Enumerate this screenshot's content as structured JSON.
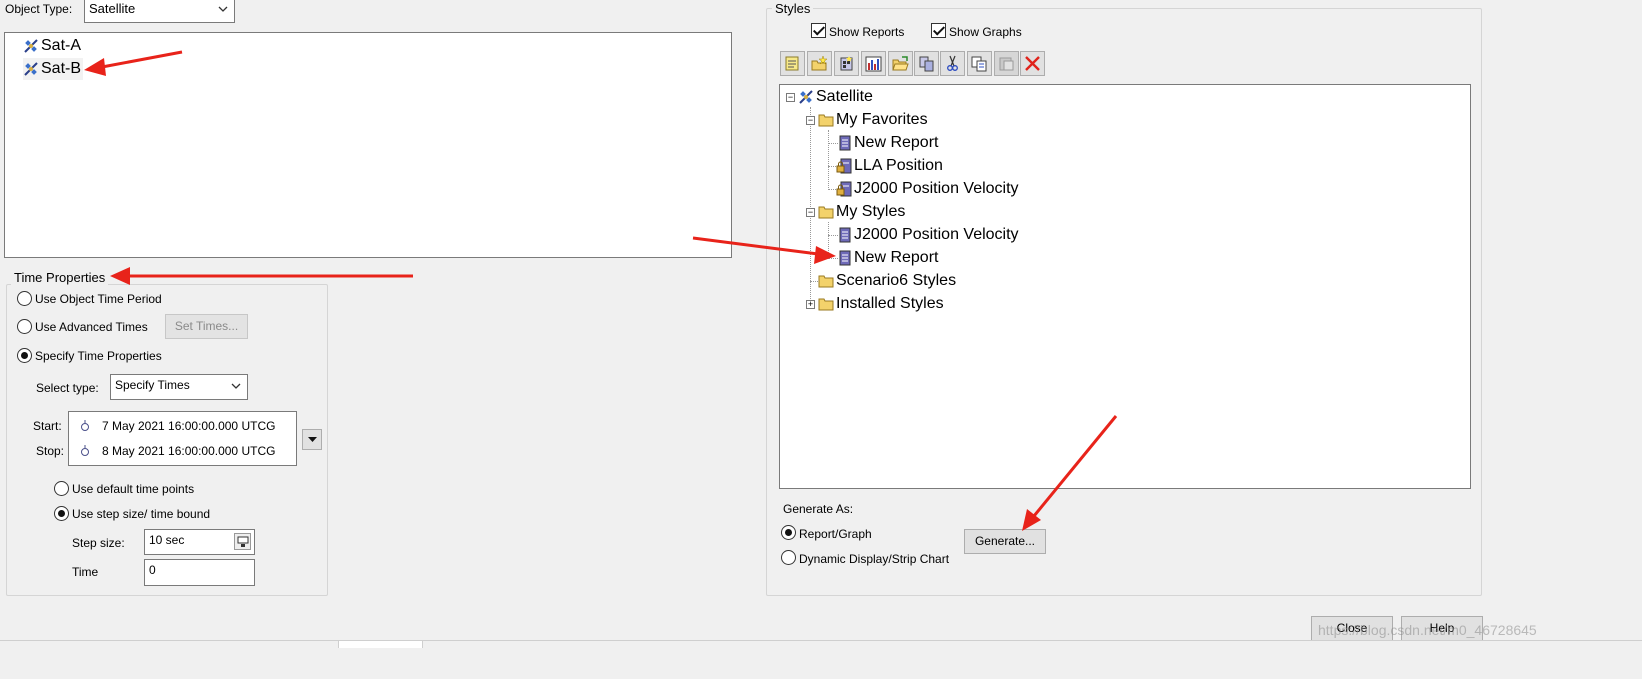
{
  "object_type": {
    "label": "Object Type:",
    "value": "Satellite"
  },
  "objects": [
    {
      "name": "Sat-A",
      "icon": "satellite-icon"
    },
    {
      "name": "Sat-B",
      "icon": "satellite-icon"
    }
  ],
  "time_properties": {
    "title": "Time Properties",
    "use_object_time_period": "Use Object Time Period",
    "use_advanced_times": "Use Advanced Times",
    "set_times_button": "Set Times...",
    "specify_time_properties": "Specify Time Properties",
    "select_type_label": "Select type:",
    "select_type_value": "Specify Times",
    "start_label": "Start:",
    "start_value": "7 May 2021 16:00:00.000 UTCG",
    "stop_label": "Stop:",
    "stop_value": "8 May 2021 16:00:00.000 UTCG",
    "use_default_time_points": "Use default time points",
    "use_step_size": "Use step size/ time bound",
    "step_size_label": "Step size:",
    "step_size_value": "10 sec",
    "time_label": "Time",
    "time_value": "0"
  },
  "styles": {
    "title": "Styles",
    "show_reports": "Show Reports",
    "show_graphs": "Show Graphs",
    "toolbar_icons": [
      "new-report-icon",
      "new-folder-icon",
      "properties-icon",
      "new-graph-icon",
      "open-folder-icon",
      "duplicate-icon",
      "cut-icon",
      "copy-icon",
      "paste-icon",
      "delete-icon"
    ],
    "tree": {
      "root": "Satellite",
      "my_favorites": "My Favorites",
      "fav_new_report": "New Report",
      "fav_lla": "LLA Position",
      "fav_j2000": "J2000 Position Velocity",
      "my_styles": "My Styles",
      "styles_j2000": "J2000 Position Velocity",
      "styles_new_report": "New Report",
      "scenario6_styles": "Scenario6 Styles",
      "installed_styles": "Installed Styles"
    }
  },
  "generate_as": {
    "label": "Generate As:",
    "report_graph": "Report/Graph",
    "dynamic_display": "Dynamic Display/Strip Chart",
    "generate_button": "Generate..."
  },
  "footer": {
    "close_button": "Close",
    "help_button": "Help",
    "watermark": "https://blog.csdn.net/m0_46728645"
  },
  "colors": {
    "annotation_arrow": "#e8231a",
    "folder": "#f3d26b",
    "report_icon": "#6e6ab8"
  }
}
